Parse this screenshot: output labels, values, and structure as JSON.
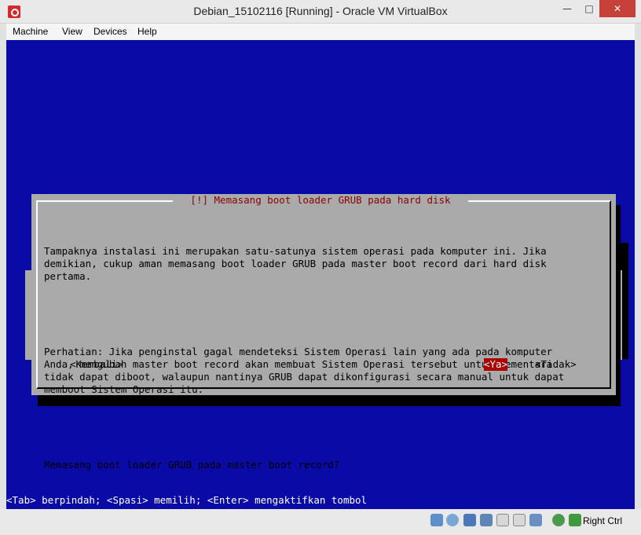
{
  "window": {
    "title": "Debian_15102116 [Running] - Oracle VM VirtualBox",
    "min_glyph": "—",
    "max_glyph": "□",
    "close_glyph": "✕"
  },
  "menu": {
    "items": [
      "Machine",
      "View",
      "Devices",
      "Help"
    ]
  },
  "dialog": {
    "title": "[!] Memasang boot loader GRUB pada hard disk",
    "paragraph1": "Tampaknya instalasi ini merupakan satu-satunya sistem operasi pada komputer ini. Jika\ndemikian, cukup aman memasang boot loader GRUB pada master boot record dari hard disk\npertama.",
    "paragraph2": "Perhatian: Jika penginstal gagal mendeteksi Sistem Operasi lain yang ada pada komputer\nAnda, mengubah master boot record akan membuat Sistem Operasi tersebut untuk sementara\ntidak dapat diboot, walaupun nantinya GRUB dapat dikonfigurasi secara manual untuk dapat\nmemboot Sistem Operasi itu.",
    "question": "Memasang boot loader GRUB pada master boot record?",
    "btn_back": "<Kembali>",
    "btn_yes": "<Ya>",
    "btn_no": "<Tidak>"
  },
  "footer": {
    "help": "<Tab> berpindah; <Spasi> memilih; <Enter> mengaktifkan tombol"
  },
  "statusbar": {
    "host_key": "Right Ctrl",
    "icons": [
      "hdd-icon",
      "optical-disk-icon",
      "usb-icon",
      "network-icon",
      "shared-folder-icon",
      "display-icon",
      "video-capture-icon",
      "mouse-integration-icon",
      "keyboard-capture-icon"
    ]
  },
  "colors": {
    "screen_bg": "#0a0aa6",
    "dialog_bg": "#aaaaaa",
    "title_red": "#8b0000",
    "selected_button": "#aa0000"
  }
}
